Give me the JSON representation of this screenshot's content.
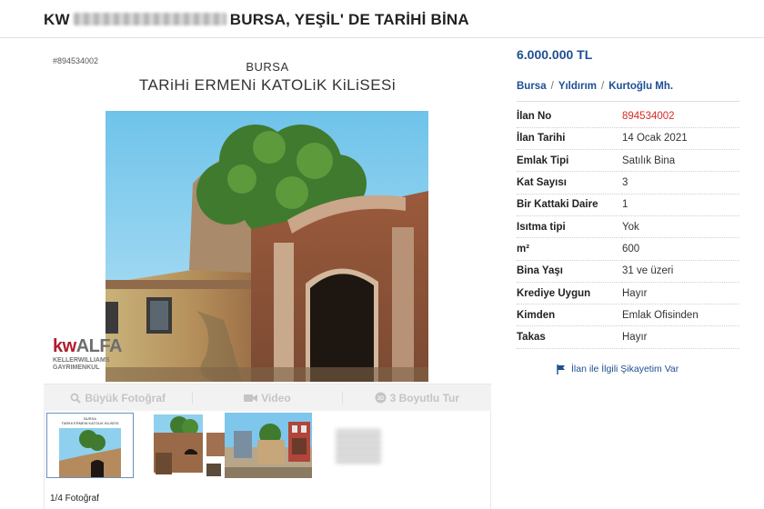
{
  "listing": {
    "title_prefix": "KW",
    "title_suffix": "BURSA, YEŞİL' DE TARİHİ BİNA",
    "price": "6.000.000 TL",
    "breadcrumb": [
      "Bursa",
      "Yıldırım",
      "Kurtoğlu Mh."
    ],
    "breadcrumb_sep": "/",
    "details": [
      {
        "label": "İlan No",
        "value": "894534002",
        "highlight": true
      },
      {
        "label": "İlan Tarihi",
        "value": "14 Ocak 2021"
      },
      {
        "label": "Emlak Tipi",
        "value": "Satılık Bina"
      },
      {
        "label": "Kat Sayısı",
        "value": "3"
      },
      {
        "label": "Bir Kattaki Daire",
        "value": "1"
      },
      {
        "label": "Isıtma tipi",
        "value": "Yok"
      },
      {
        "label": "m²",
        "value": "600"
      },
      {
        "label": "Bina Yaşı",
        "value": "31 ve üzeri"
      },
      {
        "label": "Krediye Uygun",
        "value": "Hayır"
      },
      {
        "label": "Kimden",
        "value": "Emlak Ofisinden"
      },
      {
        "label": "Takas",
        "value": "Hayır"
      }
    ],
    "complaint_link": "İlan ile İlgili Şikayetim Var"
  },
  "photo": {
    "listing_no_small": "#894534002",
    "poster_city": "BURSA",
    "poster_name": "TARiHi ERMENi KATOLiK KiLiSESi",
    "watermark_kw": "kw",
    "watermark_name": "ALFA",
    "watermark_line1": "KELLERWILLIAMS",
    "watermark_line2": "GAYRIMENKUL",
    "thumb1_city": "BURSA",
    "thumb1_name": "TARiHi ERMENi KATOLiK KiLiSESi"
  },
  "media_tabs": [
    {
      "label": "Büyük Fotoğraf",
      "icon": "search-icon"
    },
    {
      "label": "Video",
      "icon": "video-camera-icon"
    },
    {
      "label": "3 Boyutlu Tur",
      "icon": "cube-icon"
    }
  ],
  "photo_counter": "1/4 Fotoğraf",
  "colors": {
    "link_blue": "#1d4f91",
    "highlight_red": "#d82a2a",
    "watermark_red": "#b01c2e"
  }
}
